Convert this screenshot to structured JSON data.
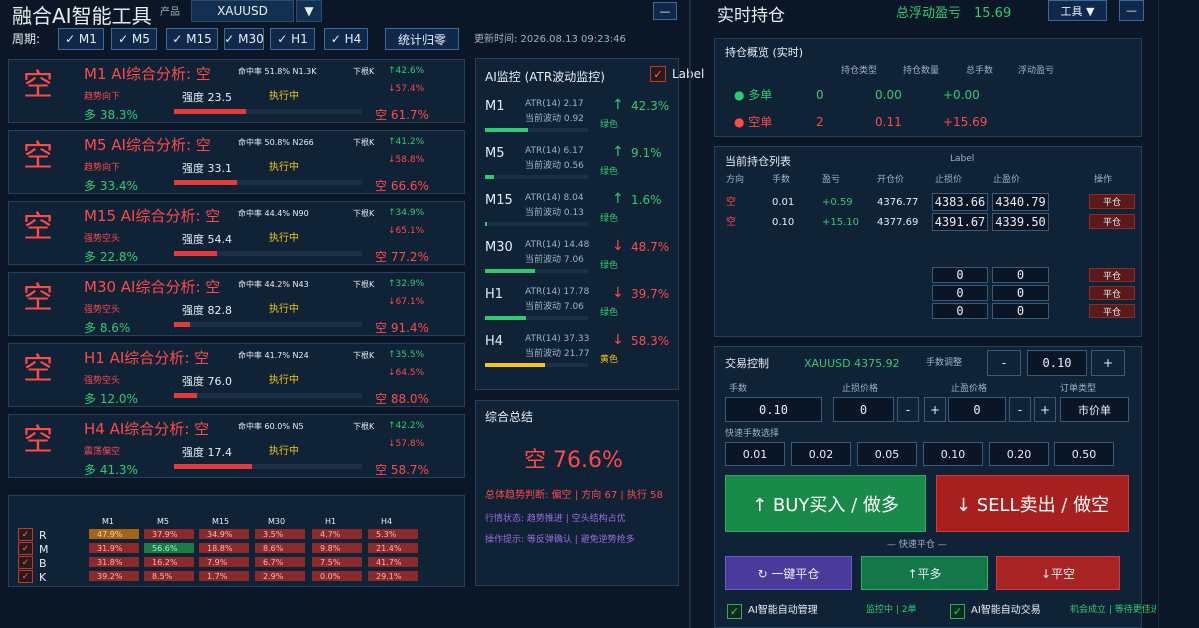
{
  "header": {
    "title": "融合AI智能工具",
    "product_label": "产品",
    "product_value": "XAUUSD",
    "period_label": "周期:",
    "periods": [
      "✓ M1",
      "✓ M5",
      "✓ M15",
      "✓ M30",
      "✓ H1",
      "✓ H4"
    ],
    "stats_reset": "统计归零",
    "update_time": "更新时间: 2026.08.13 09:23:46",
    "minimize": "—"
  },
  "analysis": [
    {
      "glyph": "空",
      "title": "M1 AI综合分析: 空",
      "hit": "命中率 51.8% N1.3K",
      "next": "下根K",
      "up": "↑42.6%",
      "down": "↓57.4%",
      "trend": "趋势向下",
      "strength": "强度 23.5",
      "exec": "执行中",
      "long": "多 38.3%",
      "short": "空 61.7%",
      "fill": 0.383
    },
    {
      "glyph": "空",
      "title": "M5 AI综合分析: 空",
      "hit": "命中率 50.8% N266",
      "next": "下根K",
      "up": "↑41.2%",
      "down": "↓58.8%",
      "trend": "趋势向下",
      "strength": "强度 33.1",
      "exec": "执行中",
      "long": "多 33.4%",
      "short": "空 66.6%",
      "fill": 0.334
    },
    {
      "glyph": "空",
      "title": "M15 AI综合分析: 空",
      "hit": "命中率 44.4% N90",
      "next": "下根K",
      "up": "↑34.9%",
      "down": "↓65.1%",
      "trend": "强势空头",
      "strength": "强度 54.4",
      "exec": "执行中",
      "long": "多 22.8%",
      "short": "空 77.2%",
      "fill": 0.228
    },
    {
      "glyph": "空",
      "title": "M30 AI综合分析: 空",
      "hit": "命中率 44.2% N43",
      "next": "下根K",
      "up": "↑32.9%",
      "down": "↓67.1%",
      "trend": "强势空头",
      "strength": "强度 82.8",
      "exec": "执行中",
      "long": "多 8.6%",
      "short": "空 91.4%",
      "fill": 0.086
    },
    {
      "glyph": "空",
      "title": "H1 AI综合分析: 空",
      "hit": "命中率 41.7% N24",
      "next": "下根K",
      "up": "↑35.5%",
      "down": "↓64.5%",
      "trend": "强势空头",
      "strength": "强度 76.0",
      "exec": "执行中",
      "long": "多 12.0%",
      "short": "空 88.0%",
      "fill": 0.12
    },
    {
      "glyph": "空",
      "title": "H4 AI综合分析: 空",
      "hit": "命中率 60.0% N5",
      "next": "下根K",
      "up": "↑42.2%",
      "down": "↓57.8%",
      "trend": "震荡偏空",
      "strength": "强度 17.4",
      "exec": "执行中",
      "long": "多 41.3%",
      "short": "空 58.7%",
      "fill": 0.413
    }
  ],
  "heatmap": {
    "cols": [
      "M1",
      "M5",
      "M15",
      "M30",
      "H1",
      "H4"
    ],
    "rows": [
      {
        "label": "R",
        "cells": [
          "47.9%",
          "37.9%",
          "34.9%",
          "3.5%",
          "4.7%",
          "5.3%"
        ],
        "colors": [
          "#a0651a",
          "#8b2a2a",
          "#8b2a2a",
          "#8b2a2a",
          "#8b2a2a",
          "#8b2a2a"
        ]
      },
      {
        "label": "M",
        "cells": [
          "31.9%",
          "56.6%",
          "18.8%",
          "8.6%",
          "9.8%",
          "21.4%"
        ],
        "colors": [
          "#8b2a2a",
          "#1e7a46",
          "#8b2a2a",
          "#8b2a2a",
          "#8b2a2a",
          "#8b2a2a"
        ]
      },
      {
        "label": "B",
        "cells": [
          "31.8%",
          "16.2%",
          "7.9%",
          "6.7%",
          "7.5%",
          "41.7%"
        ],
        "colors": [
          "#8b2a2a",
          "#8b2a2a",
          "#8b2a2a",
          "#8b2a2a",
          "#8b2a2a",
          "#8b2a2a"
        ]
      },
      {
        "label": "K",
        "cells": [
          "39.2%",
          "8.5%",
          "1.7%",
          "2.9%",
          "0.0%",
          "29.1%"
        ],
        "colors": [
          "#8b2a2a",
          "#8b2a2a",
          "#8b2a2a",
          "#8b2a2a",
          "#8b2a2a",
          "#8b2a2a"
        ]
      }
    ]
  },
  "atr": {
    "title": "AI监控 (ATR波动监控)",
    "checkbox_label": "Label",
    "rows": [
      {
        "tf": "M1",
        "atr": "ATR(14) 2.17",
        "wave": "当前波动 0.92",
        "arrow": "↑",
        "pct": "42.3%",
        "color": "绿色",
        "dir": "up",
        "fill": 0.42,
        "bar": "#2ecc71"
      },
      {
        "tf": "M5",
        "atr": "ATR(14) 6.17",
        "wave": "当前波动 0.56",
        "arrow": "↑",
        "pct": "9.1%",
        "color": "绿色",
        "dir": "up",
        "fill": 0.09,
        "bar": "#2ecc71"
      },
      {
        "tf": "M15",
        "atr": "ATR(14) 8.04",
        "wave": "当前波动 0.13",
        "arrow": "↑",
        "pct": "1.6%",
        "color": "绿色",
        "dir": "up",
        "fill": 0.02,
        "bar": "#2ecc71"
      },
      {
        "tf": "M30",
        "atr": "ATR(14) 14.48",
        "wave": "当前波动 7.06",
        "arrow": "↓",
        "pct": "48.7%",
        "color": "绿色",
        "dir": "down",
        "fill": 0.49,
        "bar": "#2ecc71"
      },
      {
        "tf": "H1",
        "atr": "ATR(14) 17.78",
        "wave": "当前波动 7.06",
        "arrow": "↓",
        "pct": "39.7%",
        "color": "绿色",
        "dir": "down",
        "fill": 0.4,
        "bar": "#2ecc71"
      },
      {
        "tf": "H4",
        "atr": "ATR(14) 37.33",
        "wave": "当前波动 21.77",
        "arrow": "↓",
        "pct": "58.3%",
        "color": "黄色",
        "dir": "down",
        "fill": 0.58,
        "bar": "#f5c518"
      }
    ]
  },
  "summary": {
    "title": "综合总结",
    "big": "空 76.6%",
    "line1": "总体趋势判断: 偏空 | 方向 67 | 执行 58",
    "line2": "行情状态: 趋势推进 | 空头结构占优",
    "line3": "操作提示: 等反弹确认 | 避免逆势抢多"
  },
  "positions": {
    "title": "实时持仓",
    "float_label": "总浮动盈亏",
    "float_value": "15.69",
    "tools_btn": "工具 ▼",
    "min_btn": "—",
    "overview_title": "持仓概览 (实时)",
    "overview_headers": [
      "持仓类型",
      "持仓数量",
      "总手数",
      "浮动盈亏"
    ],
    "long_row": {
      "label": "多单",
      "count": "0",
      "lots": "0.00",
      "pnl": "+0.00"
    },
    "short_row": {
      "label": "空单",
      "count": "2",
      "lots": "0.11",
      "pnl": "+15.69"
    },
    "list_title": "当前持仓列表",
    "list_label": "Label",
    "list_headers": [
      "方向",
      "手数",
      "盈亏",
      "开仓价",
      "止损价",
      "止盈价",
      "操作"
    ],
    "list_rows": [
      {
        "dir": "空",
        "lots": "0.01",
        "pnl": "+0.59",
        "open": "4376.77",
        "sl": "4383.66",
        "tp": "4340.79",
        "action": "平仓"
      },
      {
        "dir": "空",
        "lots": "0.10",
        "pnl": "+15.10",
        "open": "4377.69",
        "sl": "4391.67",
        "tp": "4339.50",
        "action": "平仓"
      }
    ],
    "empty_rows": [
      {
        "sl": "0",
        "tp": "0",
        "action": "平仓"
      },
      {
        "sl": "0",
        "tp": "0",
        "action": "平仓"
      },
      {
        "sl": "0",
        "tp": "0",
        "action": "平仓"
      }
    ]
  },
  "trade": {
    "title": "交易控制",
    "symbol_price": "XAUUSD 4375.92",
    "lot_adjust_label": "手数调整",
    "minus": "-",
    "plus": "+",
    "lot_value": "0.10",
    "lots_label": "手数",
    "lots_input": "0.10",
    "sl_label": "止损价格",
    "sl_input": "0",
    "tp_label": "止盈价格",
    "tp_input": "0",
    "order_type_label": "订单类型",
    "order_type_value": "市价单",
    "quick_lot_label": "快速手数选择",
    "quick_lots": [
      "0.01",
      "0.02",
      "0.05",
      "0.10",
      "0.20",
      "0.50"
    ],
    "buy": "↑ BUY买入 / 做多",
    "sell": "↓ SELL卖出 / 做空",
    "quick_close_label": "— 快速平仓 —",
    "close_all": "↻ 一键平仓",
    "close_long": "↑平多",
    "close_short": "↓平空",
    "auto_manage": "AI智能自动管理",
    "monitoring": "监控中 | 2单",
    "auto_trade": "AI智能自动交易",
    "opportunity": "机会成立 | 等待更佳进场价格"
  },
  "colors": {
    "bg": "#0b1726",
    "panel": "#0f2236",
    "red": "#ff4a4a",
    "green": "#2ecc71",
    "accent": "#3c6a96"
  }
}
